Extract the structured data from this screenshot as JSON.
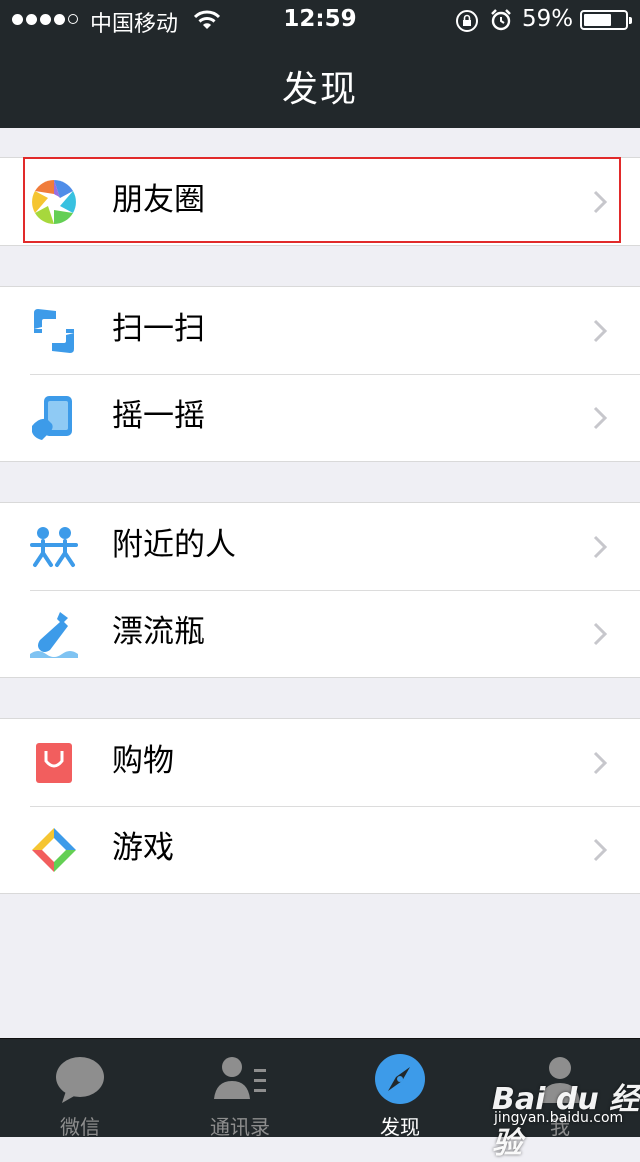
{
  "status_bar": {
    "carrier": "中国移动",
    "time": "12:59",
    "battery_percent": "59%",
    "battery_level": 0.59,
    "signal_bars_filled": 4,
    "signal_bars_total": 5
  },
  "nav": {
    "title": "发现"
  },
  "groups": [
    {
      "items": [
        {
          "label": "朋友圈",
          "icon": "moments-icon",
          "highlighted": true
        }
      ]
    },
    {
      "items": [
        {
          "label": "扫一扫",
          "icon": "scan-icon"
        },
        {
          "label": "摇一摇",
          "icon": "shake-icon"
        }
      ]
    },
    {
      "items": [
        {
          "label": "附近的人",
          "icon": "people-nearby-icon"
        },
        {
          "label": "漂流瓶",
          "icon": "drift-bottle-icon"
        }
      ]
    },
    {
      "items": [
        {
          "label": "购物",
          "icon": "shopping-bag-icon"
        },
        {
          "label": "游戏",
          "icon": "games-icon"
        }
      ]
    }
  ],
  "tabs": [
    {
      "label": "微信",
      "icon": "chat-bubble-icon",
      "active": false
    },
    {
      "label": "通讯录",
      "icon": "contacts-icon",
      "active": false
    },
    {
      "label": "发现",
      "icon": "compass-icon",
      "active": true
    },
    {
      "label": "我",
      "icon": "profile-icon",
      "active": false
    }
  ],
  "watermark": {
    "brand": "Bai du 经验",
    "url": "jingyan.baidu.com"
  },
  "colors": {
    "bar_background": "#22282b",
    "page_background": "#efeff4",
    "highlight_border": "#e12a2a",
    "accent_blue": "#3d9be9",
    "inactive_tab": "#8e8e8e"
  }
}
